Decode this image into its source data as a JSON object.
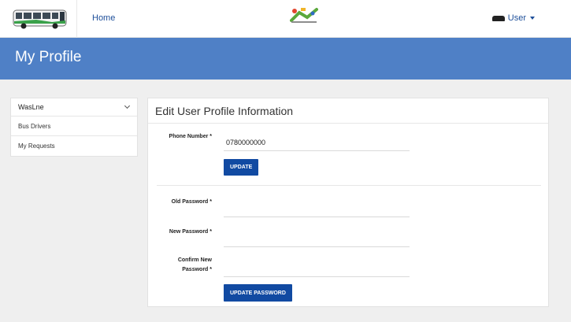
{
  "nav": {
    "home_label": "Home",
    "user_label": "User"
  },
  "banner": {
    "title": "My Profile"
  },
  "sidebar": {
    "items": [
      {
        "label": "WasLne"
      },
      {
        "label": "Bus Drivers"
      },
      {
        "label": "My Requests"
      }
    ]
  },
  "form": {
    "title": "Edit User Profile Information",
    "phone_label": "Phone Number *",
    "phone_value": "0780000000",
    "update_label": "UPDATE",
    "old_password_label": "Old Password *",
    "new_password_label": "New Password *",
    "confirm_label_line1": "Confirm New",
    "confirm_label_line2": "Password *",
    "update_password_label": "UPDATE PASSWORD"
  },
  "colors": {
    "banner": "#4f80c6",
    "button": "#114aa2",
    "link": "#1e4f9a"
  }
}
